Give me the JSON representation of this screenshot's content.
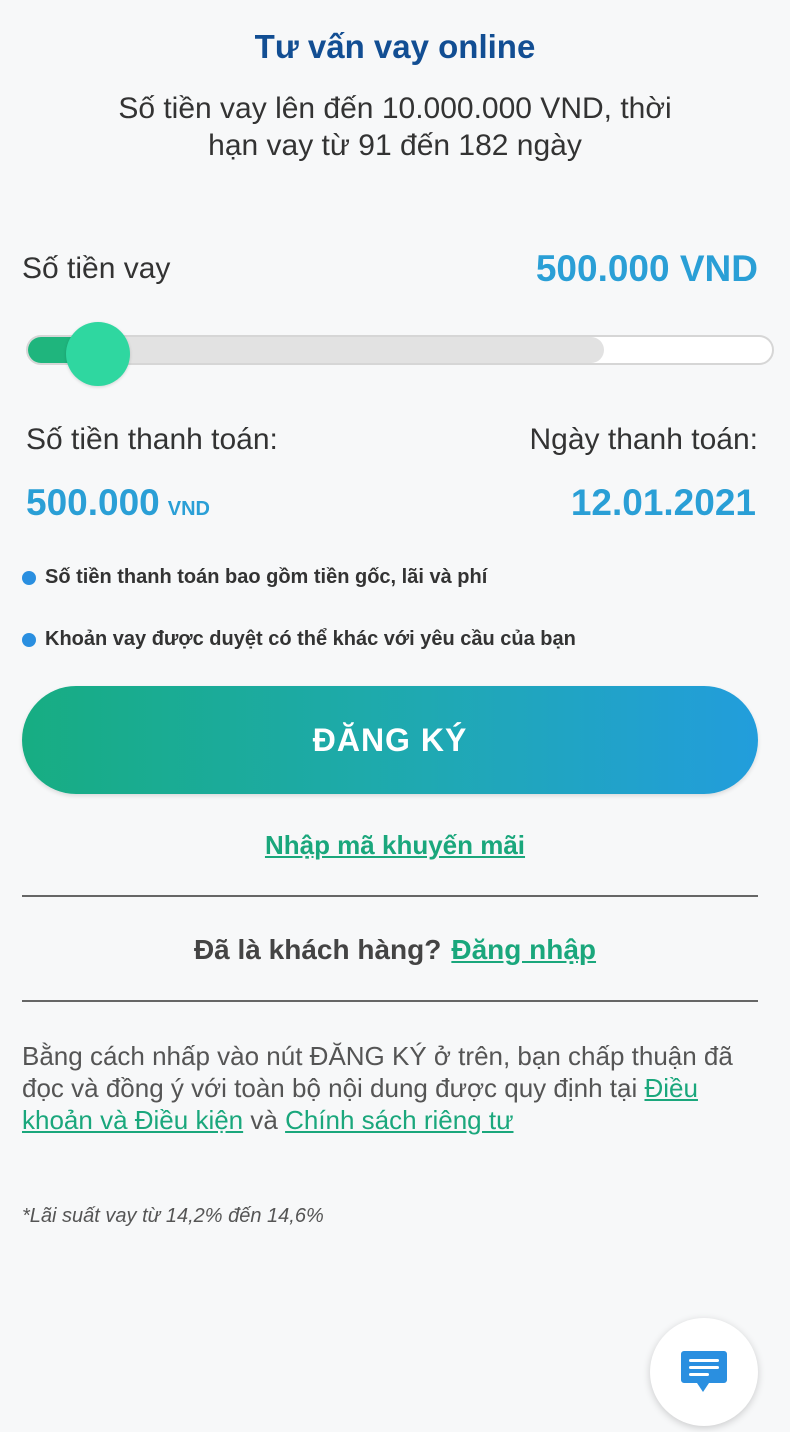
{
  "header": {
    "title": "Tư vấn vay online",
    "subtitle": "Số tiền vay lên đến 10.000.000 VND, thời hạn vay từ 91 đến 182 ngày"
  },
  "loan": {
    "amount_label": "Số tiền vay",
    "amount_value": "500.000 VND",
    "slider_fraction": 0.05
  },
  "payment": {
    "amount_label": "Số tiền thanh toán:",
    "amount_value": "500.000",
    "amount_unit": "VND",
    "date_label": "Ngày thanh toán:",
    "date_value": "12.01.2021"
  },
  "notes": [
    "Số tiền thanh toán bao gồm tiền gốc, lãi và phí",
    "Khoản vay được duyệt có thể khác với yêu cầu của bạn"
  ],
  "actions": {
    "register_label": "ĐĂNG KÝ",
    "promo_label": "Nhập mã khuyến mãi"
  },
  "customer": {
    "question": "Đã là khách hàng?",
    "login_label": "Đăng nhập"
  },
  "terms": {
    "text": "Bằng cách nhấp vào nút ĐĂNG KÝ ở trên, bạn chấp thuận đã đọc và đồng ý với toàn bộ nội dung được quy định tại",
    "terms_link": "Điều khoản và Điều kiện",
    "and": "và",
    "privacy_link": "Chính sách riêng tư"
  },
  "rate_note": "*Lãi suất vay từ 14,2% đến 14,6%",
  "chat": {
    "icon": "chat-icon"
  },
  "colors": {
    "title": "#124e93",
    "accent_value": "#2a9fd6",
    "link_green": "#1aa77c",
    "button_start": "#17ad82",
    "button_end": "#229ddc"
  }
}
